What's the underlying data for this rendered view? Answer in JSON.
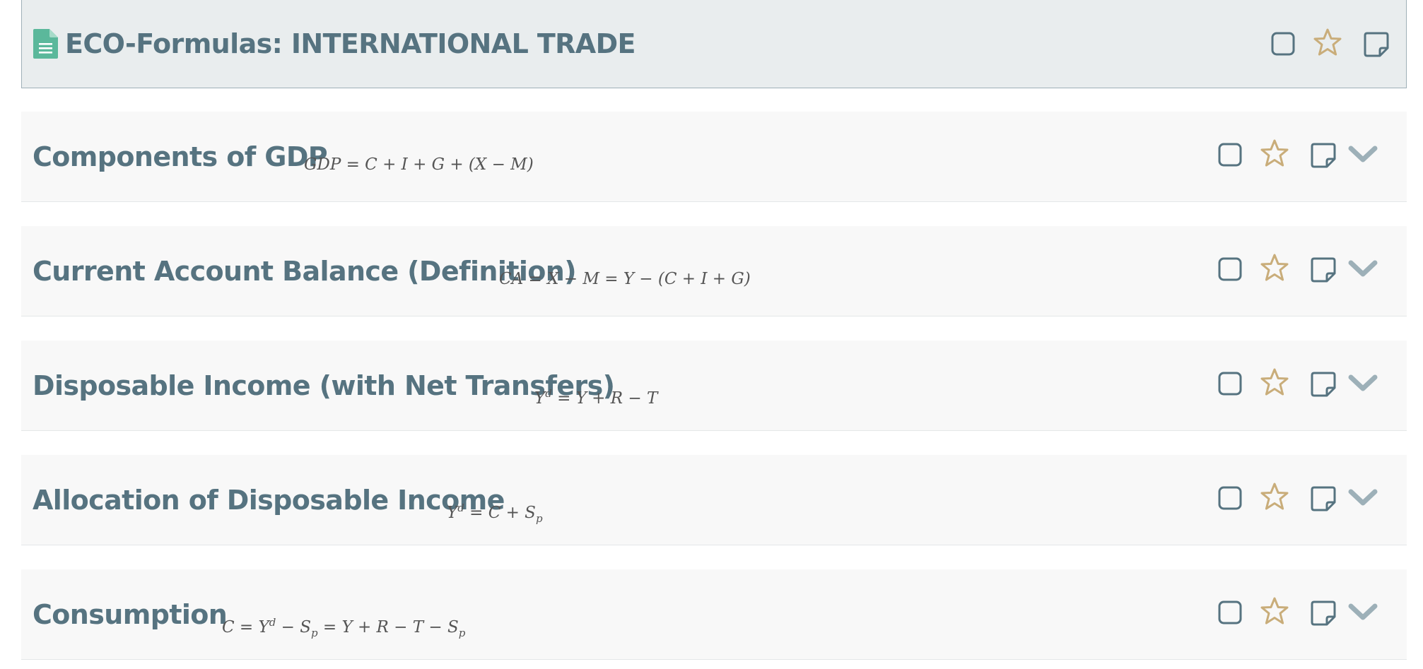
{
  "header": {
    "title": "ECO-Formulas: INTERNATIONAL TRADE",
    "icons": [
      "document-icon",
      "checkbox-icon",
      "star-icon",
      "note-icon"
    ]
  },
  "cards": [
    {
      "title": "Components of GDP",
      "formula": "GDP = C + I + G + (X − M)"
    },
    {
      "title": "Current Account Balance (Definition)",
      "formula": "CA = X − M = Y − (C + I + G)"
    },
    {
      "title": "Disposable Income (with Net Transfers)",
      "formula": "Yd = Y + R − T"
    },
    {
      "title": "Allocation of Disposable Income",
      "formula": "Yd = C + Sp"
    },
    {
      "title": "Consumption",
      "formula": "C = Yd − Sp = Y + R − T − Sp"
    }
  ],
  "card_icons": [
    "checkbox-icon",
    "star-icon",
    "note-icon",
    "chevron-down-icon"
  ],
  "colors": {
    "title": "#567380",
    "icon_outline": "#567380",
    "star": "#c9ad7a",
    "chevron": "#9db0b8",
    "doc_icon": "#5bb89b",
    "header_bg": "#e9edee",
    "card_bg": "#f8f8f8"
  }
}
